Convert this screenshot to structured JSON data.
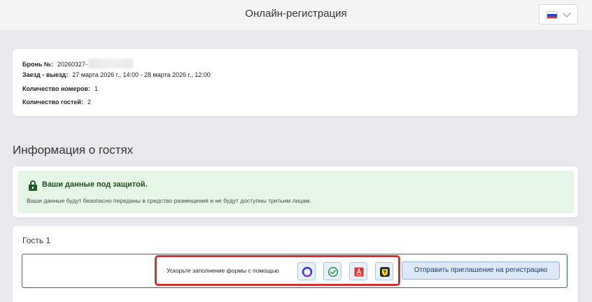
{
  "header": {
    "title": "Онлайн-регистрация",
    "language_flag": "russian-flag-icon"
  },
  "booking": {
    "number_label": "Бронь №:",
    "number_value": "20260327-",
    "dates_label": "Заезд - выезд:",
    "dates_value": "27 марта 2026 г., 14:00 - 28 марта 2026 г., 12:00",
    "rooms_label": "Количество номеров:",
    "rooms_value": "1",
    "guests_label": "Количество гостей:",
    "guests_value": "2"
  },
  "guests_section": {
    "title": "Информация о гостях"
  },
  "security_notice": {
    "title": "Ваши данные под защитой.",
    "text": "Ваши данные будут безопасно переданы в средство размещения и не будут доступны третьим лицам.",
    "icon": "lock-icon"
  },
  "guest": {
    "title": "Гость 1",
    "fill_label": "Ускорьте заполнение формы с помощью",
    "services": [
      "alice-icon",
      "check-circle-icon",
      "alfa-bank-icon",
      "tinkoff-shield-icon"
    ],
    "invite_button": "Отправить приглашение на регистрацию"
  },
  "colors": {
    "page_background": "#e8e9ec",
    "success_background": "#e6f6e6",
    "success_text": "#1d4a22",
    "highlight_border": "#d32f2f",
    "button_background": "#dde9f8"
  }
}
